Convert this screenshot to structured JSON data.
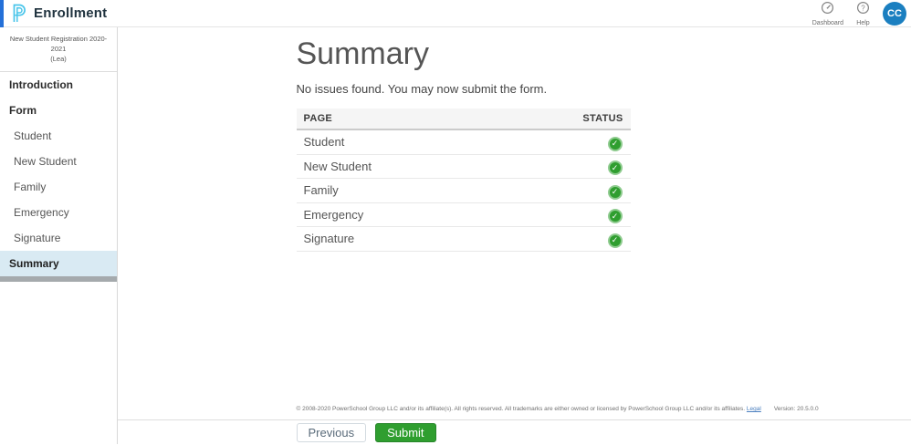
{
  "header": {
    "brand": "Enrollment",
    "nav": [
      {
        "label": "Dashboard",
        "icon": "dashboard-gauge-icon"
      },
      {
        "label": "Help",
        "icon": "help-question-icon"
      }
    ],
    "avatar_initials": "CC"
  },
  "sidebar": {
    "form_title_line1": "New Student Registration 2020-2021",
    "form_title_line2": "(Lea)",
    "items": [
      {
        "label": "Introduction",
        "type": "section",
        "active": false
      },
      {
        "label": "Form",
        "type": "section",
        "active": false
      },
      {
        "label": "Student",
        "type": "sub",
        "active": false
      },
      {
        "label": "New Student",
        "type": "sub",
        "active": false
      },
      {
        "label": "Family",
        "type": "sub",
        "active": false
      },
      {
        "label": "Emergency",
        "type": "sub",
        "active": false
      },
      {
        "label": "Signature",
        "type": "sub",
        "active": false
      },
      {
        "label": "Summary",
        "type": "section",
        "active": true
      }
    ]
  },
  "main": {
    "title": "Summary",
    "message": "No issues found. You may now submit the form.",
    "table": {
      "columns": [
        "PAGE",
        "STATUS"
      ],
      "rows": [
        {
          "page": "Student",
          "status": "complete"
        },
        {
          "page": "New Student",
          "status": "complete"
        },
        {
          "page": "Family",
          "status": "complete"
        },
        {
          "page": "Emergency",
          "status": "complete"
        },
        {
          "page": "Signature",
          "status": "complete"
        }
      ]
    },
    "legal": {
      "copyright": "© 2008-2020 PowerSchool Group LLC and/or its affiliate(s). All rights reserved. All trademarks are either owned or licensed by PowerSchool Group LLC and/or its affiliates.",
      "legal_link": "Legal",
      "version": "Version: 20.5.0.0"
    }
  },
  "action_bar": {
    "previous_label": "Previous",
    "submit_label": "Submit"
  },
  "colors": {
    "brand_cyan": "#49c5ea",
    "edge_blue": "#2470d8",
    "avatar_blue": "#1b7fc0",
    "success_green": "#2f9e2f",
    "active_item_bg": "#d9eaf3"
  }
}
